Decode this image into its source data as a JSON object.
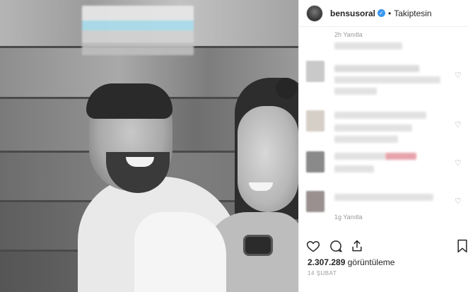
{
  "header": {
    "username": "bensusoral",
    "separator": "•",
    "follow_state": "Takiptesin"
  },
  "comments": {
    "top_meta": "2h   Yanıtla",
    "bottom_meta": "1g   Yanıtla",
    "heart_glyph": "♡"
  },
  "actions": {
    "like_icon": "heart-icon",
    "comment_icon": "comment-icon",
    "share_icon": "share-icon",
    "save_icon": "bookmark-icon"
  },
  "stats": {
    "view_count": "2.307.289",
    "view_label": " görüntüleme"
  },
  "post_date": "14 ŞUBAT",
  "colors": {
    "verified_blue": "#3897f0",
    "text_dark": "#262626",
    "meta_gray": "#999999"
  }
}
